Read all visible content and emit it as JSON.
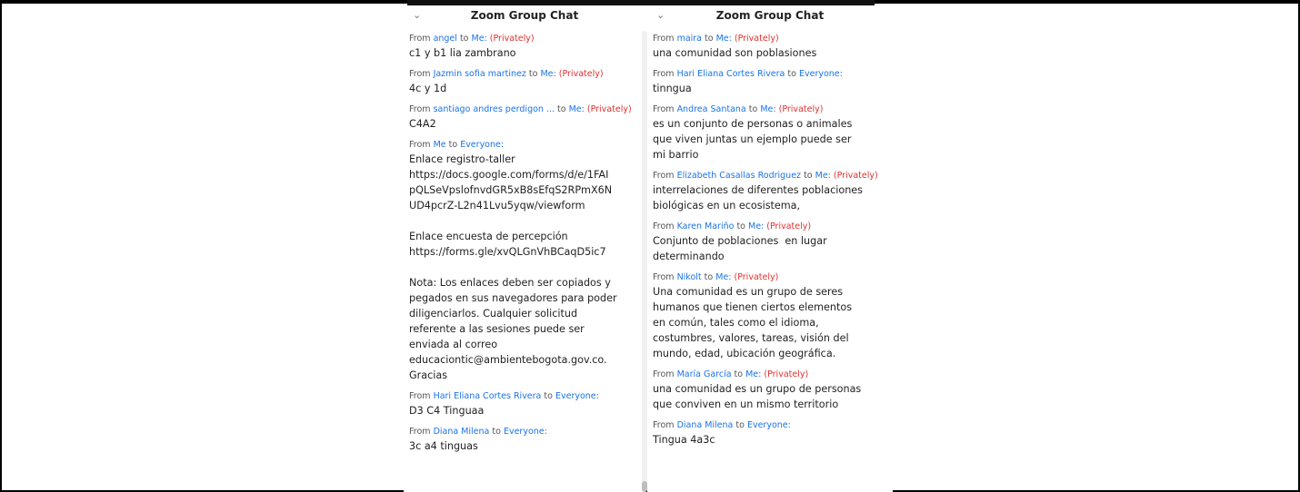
{
  "left_panel": {
    "title": "Zoom Group Chat",
    "messages": [
      {
        "from_prefix": "From ",
        "sender": "angel",
        "to_prefix": " to ",
        "recipient": "Me:",
        "privately": " (Privately)",
        "body": "c1 y b1 lia zambrano"
      },
      {
        "from_prefix": "From ",
        "sender": "Jazmin sofia martinez",
        "to_prefix": " to ",
        "recipient": "Me:",
        "privately": " (Privately)",
        "body": "4c y 1d"
      },
      {
        "from_prefix": "From ",
        "sender": "santiago andres perdigon ...",
        "to_prefix": " to ",
        "recipient": "Me:",
        "privately": " (Privately)",
        "body": "C4A2"
      },
      {
        "from_prefix": "From ",
        "sender": "Me",
        "to_prefix": " to ",
        "recipient": "Everyone:",
        "privately": "",
        "body": "Enlace registro-taller\nhttps://docs.google.com/forms/d/e/1FAI\npQLSeVpslofnvdGR5xB8sEfqS2RPmX6N\nUD4pcrZ-L2n41Lvu5yqw/viewform\n\nEnlace encuesta de percepción\nhttps://forms.gle/xvQLGnVhBCaqD5ic7\n\nNota: Los enlaces deben ser copiados y\npegados en sus navegadores para poder\ndiligenciarlos. Cualquier solicitud\nreferente a las sesiones puede ser\nenviada al correo\neducaciontic@ambientebogota.gov.co.\nGracias"
      },
      {
        "from_prefix": "From ",
        "sender": "Hari Eliana Cortes Rivera",
        "to_prefix": " to ",
        "recipient": "Everyone:",
        "privately": "",
        "body": "D3 C4 Tinguaa"
      },
      {
        "from_prefix": "From ",
        "sender": "Diana Milena",
        "to_prefix": " to ",
        "recipient": "Everyone:",
        "privately": "",
        "body": "3c a4 tinguas"
      }
    ]
  },
  "right_panel": {
    "title": "Zoom Group Chat",
    "messages": [
      {
        "from_prefix": "From ",
        "sender": "maira",
        "to_prefix": " to ",
        "recipient": "Me:",
        "privately": " (Privately)",
        "body": "una comunidad son poblasiones"
      },
      {
        "from_prefix": "From ",
        "sender": "Hari Eliana Cortes Rivera",
        "to_prefix": " to ",
        "recipient": "Everyone:",
        "privately": "",
        "body": "tinngua"
      },
      {
        "from_prefix": "From ",
        "sender": "Andrea Santana",
        "to_prefix": " to ",
        "recipient": "Me:",
        "privately": " (Privately)",
        "body": "es un conjunto de personas o animales\nque viven juntas un ejemplo puede ser\nmi barrio"
      },
      {
        "from_prefix": "From ",
        "sender": "Elizabeth Casallas Rodriguez",
        "to_prefix": " to ",
        "recipient": "Me:",
        "privately": " (Privately)",
        "body": "interrelaciones de diferentes poblaciones\nbiológicas en un ecosistema,"
      },
      {
        "from_prefix": "From ",
        "sender": "Karen Mariño",
        "to_prefix": " to ",
        "recipient": "Me:",
        "privately": " (Privately)",
        "body": "Conjunto de poblaciones  en lugar\ndeterminando"
      },
      {
        "from_prefix": "From ",
        "sender": "Nikolt",
        "to_prefix": " to ",
        "recipient": "Me:",
        "privately": " (Privately)",
        "body": "Una comunidad es un grupo de seres\nhumanos que tienen ciertos elementos\nen común, tales como el idioma,\ncostumbres, valores, tareas, visión del\nmundo, edad, ubicación geográfica."
      },
      {
        "from_prefix": "From ",
        "sender": "María García",
        "to_prefix": " to ",
        "recipient": "Me:",
        "privately": " (Privately)",
        "body": "una comunidad es un grupo de personas\nque conviven en un mismo territorio"
      },
      {
        "from_prefix": "From ",
        "sender": "Diana Milena",
        "to_prefix": " to ",
        "recipient": "Everyone:",
        "privately": "",
        "body": "Tingua 4a3c"
      }
    ]
  },
  "icons": {
    "collapse": "chevron-down-icon"
  },
  "colors": {
    "name_link": "#1a73e8",
    "privately": "#e0302f",
    "body_text": "#222222",
    "meta_text": "#555555"
  }
}
